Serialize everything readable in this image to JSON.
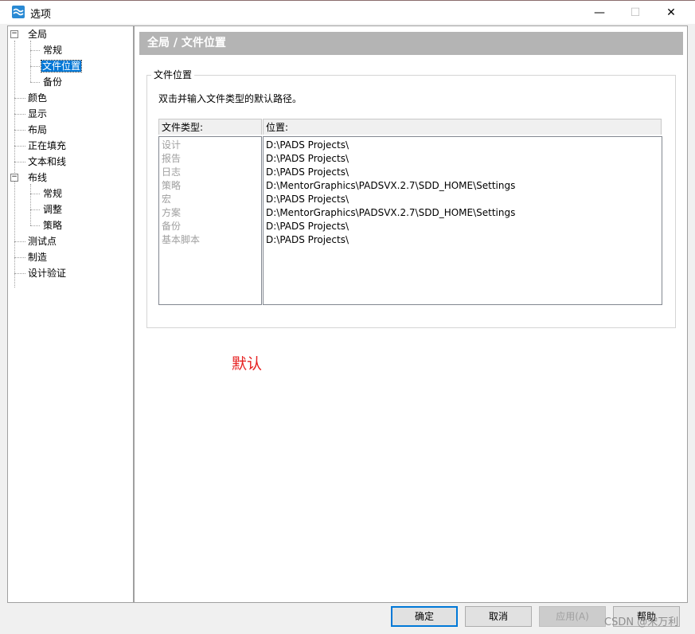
{
  "window": {
    "title": "选项",
    "minimize": "—",
    "maximize": "☐",
    "close": "✕",
    "icon": "app-logo-icon",
    "accent": "#0078d7"
  },
  "tree": {
    "items": [
      {
        "label": "全局",
        "expander": "−"
      },
      {
        "label": "常规"
      },
      {
        "label": "文件位置",
        "selected": true
      },
      {
        "label": "备份"
      },
      {
        "label": "颜色"
      },
      {
        "label": "显示"
      },
      {
        "label": "布局"
      },
      {
        "label": "正在填充"
      },
      {
        "label": "文本和线"
      },
      {
        "label": "布线",
        "expander": "−"
      },
      {
        "label": "常规"
      },
      {
        "label": "调整"
      },
      {
        "label": "策略"
      },
      {
        "label": "测试点"
      },
      {
        "label": "制造"
      },
      {
        "label": "设计验证"
      }
    ]
  },
  "content": {
    "header": "全局 / 文件位置",
    "group_title": "文件位置",
    "instruction": "双击并输入文件类型的默认路径。",
    "columns": {
      "type": "文件类型:",
      "location": "位置:"
    },
    "rows": [
      {
        "type": "设计",
        "path": "D:\\PADS Projects\\"
      },
      {
        "type": "报告",
        "path": "D:\\PADS Projects\\"
      },
      {
        "type": "日志",
        "path": "D:\\PADS Projects\\"
      },
      {
        "type": "策略",
        "path": "D:\\MentorGraphics\\PADSVX.2.7\\SDD_HOME\\Settings"
      },
      {
        "type": "宏",
        "path": "D:\\PADS Projects\\"
      },
      {
        "type": "方案",
        "path": "D:\\MentorGraphics\\PADSVX.2.7\\SDD_HOME\\Settings"
      },
      {
        "type": "备份",
        "path": "D:\\PADS Projects\\"
      },
      {
        "type": "基本脚本",
        "path": "D:\\PADS Projects\\"
      }
    ],
    "note": "默认",
    "note_color": "#e62020"
  },
  "buttons": {
    "ok": "确定",
    "cancel": "取消",
    "apply": "应用(A)",
    "help": "帮助"
  },
  "watermark": "CSDN @宋万利"
}
